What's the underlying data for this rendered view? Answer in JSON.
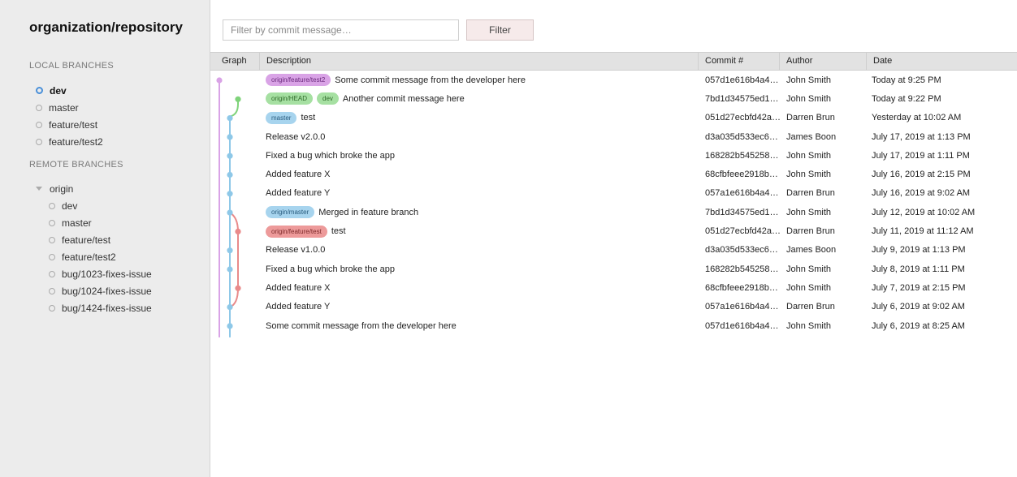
{
  "repo": {
    "title": "organization/repository"
  },
  "local": {
    "title": "LOCAL BRANCHES",
    "branches": [
      {
        "name": "dev",
        "active": true
      },
      {
        "name": "master"
      },
      {
        "name": "feature/test"
      },
      {
        "name": "feature/test2"
      }
    ]
  },
  "remote": {
    "title": "REMOTE BRANCHES",
    "remote_name": "origin",
    "branches": [
      "dev",
      "master",
      "feature/test",
      "feature/test2",
      "bug/1023-fixes-issue",
      "bug/1024-fixes-issue",
      "bug/1424-fixes-issue"
    ]
  },
  "filter": {
    "placeholder": "Filter by commit message…",
    "button": "Filter"
  },
  "table": {
    "headers": {
      "graph": "Graph",
      "description": "Description",
      "commit": "Commit #",
      "author": "Author",
      "date": "Date"
    },
    "rows": [
      {
        "tags": [
          {
            "label": "origin/feature/test2",
            "color": "purple"
          }
        ],
        "message": "Some commit message from the developer here",
        "hash": "057d1e616b4a4…",
        "author": "John Smith",
        "date": "Today at 9:25 PM"
      },
      {
        "tags": [
          {
            "label": "origin/HEAD",
            "color": "green"
          },
          {
            "label": "dev",
            "color": "green"
          }
        ],
        "message": "Another commit message here",
        "hash": "7bd1d34575ed1…",
        "author": "John Smith",
        "date": "Today at 9:22 PM"
      },
      {
        "tags": [
          {
            "label": "master",
            "color": "blue"
          }
        ],
        "message": "test",
        "hash": "051d27ecbfd42a…",
        "author": "Darren Brun",
        "date": "Yesterday at 10:02 AM"
      },
      {
        "tags": [],
        "message": "Release v2.0.0",
        "hash": "d3a035d533ec6…",
        "author": "James Boon",
        "date": "July 17, 2019 at 1:13 PM"
      },
      {
        "tags": [],
        "message": "Fixed a bug which broke the app",
        "hash": "168282b545258…",
        "author": "John Smith",
        "date": "July 17, 2019 at 1:11 PM"
      },
      {
        "tags": [],
        "message": "Added feature X",
        "hash": "68cfbfeee2918b…",
        "author": "John Smith",
        "date": "July 16, 2019 at 2:15 PM"
      },
      {
        "tags": [],
        "message": "Added feature Y",
        "hash": "057a1e616b4a4…",
        "author": "Darren Brun",
        "date": "July 16, 2019 at 9:02 AM"
      },
      {
        "tags": [
          {
            "label": "origin/master",
            "color": "blue"
          }
        ],
        "message": "Merged in feature branch",
        "hash": "7bd1d34575ed1…",
        "author": "John Smith",
        "date": "July 12, 2019 at 10:02 AM"
      },
      {
        "tags": [
          {
            "label": "origin/feature/test",
            "color": "red"
          }
        ],
        "message": "test",
        "hash": "051d27ecbfd42a…",
        "author": "Darren Brun",
        "date": "July 11, 2019 at 11:12 AM"
      },
      {
        "tags": [],
        "message": "Release v1.0.0",
        "hash": "d3a035d533ec6…",
        "author": "James Boon",
        "date": "July 9, 2019 at 1:13 PM"
      },
      {
        "tags": [],
        "message": "Fixed a bug which broke the app",
        "hash": "168282b545258…",
        "author": "John Smith",
        "date": "July 8, 2019 at 1:11 PM"
      },
      {
        "tags": [],
        "message": "Added feature X",
        "hash": "68cfbfeee2918b…",
        "author": "John Smith",
        "date": "July 7, 2019 at 2:15 PM"
      },
      {
        "tags": [],
        "message": "Added feature Y",
        "hash": "057a1e616b4a4…",
        "author": "Darren Brun",
        "date": "July 6, 2019 at 9:02 AM"
      },
      {
        "tags": [],
        "message": "Some commit message from the developer here",
        "hash": "057d1e616b4a4…",
        "author": "John Smith",
        "date": "July 6, 2019 at 8:25 AM"
      }
    ]
  },
  "graph_colors": {
    "purple": "#d9a3e6",
    "green": "#7fd37a",
    "blue": "#8ec8e8",
    "red": "#e98a8a"
  }
}
